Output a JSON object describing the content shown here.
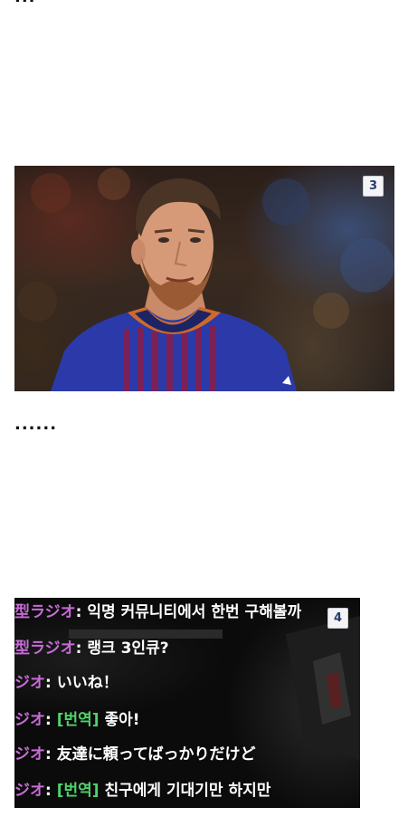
{
  "top_dots": "...",
  "middle_dots": "......",
  "photo": {
    "badge": "3"
  },
  "chat": {
    "badge": "4",
    "lines": [
      {
        "speaker": "型ラジオ",
        "colon": ":",
        "tag": "",
        "message": "익명 커뮤니티에서 한번 구해볼까"
      },
      {
        "speaker": "型ラジオ",
        "colon": ":",
        "tag": "",
        "message": "랭크 3인큐?"
      },
      {
        "speaker": "ジオ",
        "colon": ":",
        "tag": "",
        "message": "いいね！"
      },
      {
        "speaker": "ジオ",
        "colon": ":",
        "tag": "[번역]",
        "message": "좋아!"
      },
      {
        "speaker": "ジオ",
        "colon": ":",
        "tag": "",
        "message": "友達に頼ってばっかりだけど"
      },
      {
        "speaker": "ジオ",
        "colon": ":",
        "tag": "[번역]",
        "message": "친구에게 기대기만 하지만"
      }
    ]
  }
}
